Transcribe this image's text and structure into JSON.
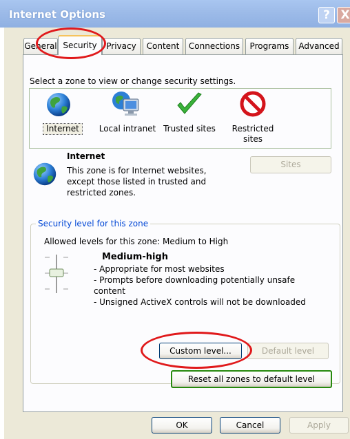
{
  "window": {
    "title": "Internet Options",
    "help_label": "?",
    "close_label": "X"
  },
  "tabs": [
    {
      "label": "General",
      "active": false
    },
    {
      "label": "Security",
      "active": true
    },
    {
      "label": "Privacy",
      "active": false
    },
    {
      "label": "Content",
      "active": false
    },
    {
      "label": "Connections",
      "active": false
    },
    {
      "label": "Programs",
      "active": false
    },
    {
      "label": "Advanced",
      "active": false
    }
  ],
  "security": {
    "instruction": "Select a zone to view or change security settings.",
    "zones": [
      {
        "label": "Internet",
        "icon": "globe-icon",
        "selected": true
      },
      {
        "label": "Local intranet",
        "icon": "network-computer-icon",
        "selected": false
      },
      {
        "label": "Trusted sites",
        "icon": "checkmark-icon",
        "selected": false
      },
      {
        "label": "Restricted sites",
        "icon": "restricted-icon",
        "selected": false
      }
    ],
    "zone_info": {
      "name": "Internet",
      "description_line1": "This zone is for Internet websites,",
      "description_line2": "except those listed in trusted and",
      "description_line3": "restricted zones."
    },
    "sites_button": "Sites",
    "level_group_title": "Security level for this zone",
    "allowed_levels": "Allowed levels for this zone: Medium to High",
    "level_name": "Medium-high",
    "level_details": [
      "- Appropriate for most websites",
      "- Prompts before downloading potentially unsafe",
      "content",
      "- Unsigned ActiveX controls will not be downloaded"
    ],
    "custom_level_button": "Custom level...",
    "default_level_button": "Default level",
    "reset_all_button": "Reset all zones to default level"
  },
  "footer": {
    "ok": "OK",
    "cancel": "Cancel",
    "apply": "Apply"
  },
  "colors": {
    "titlebar": "#9ebce9",
    "dialog_bg": "#ece9d8",
    "panel_bg": "#fcfcfe",
    "annotation_red": "#e0191b",
    "group_title_blue": "#0046d5",
    "default_button_green": "#26890d"
  }
}
